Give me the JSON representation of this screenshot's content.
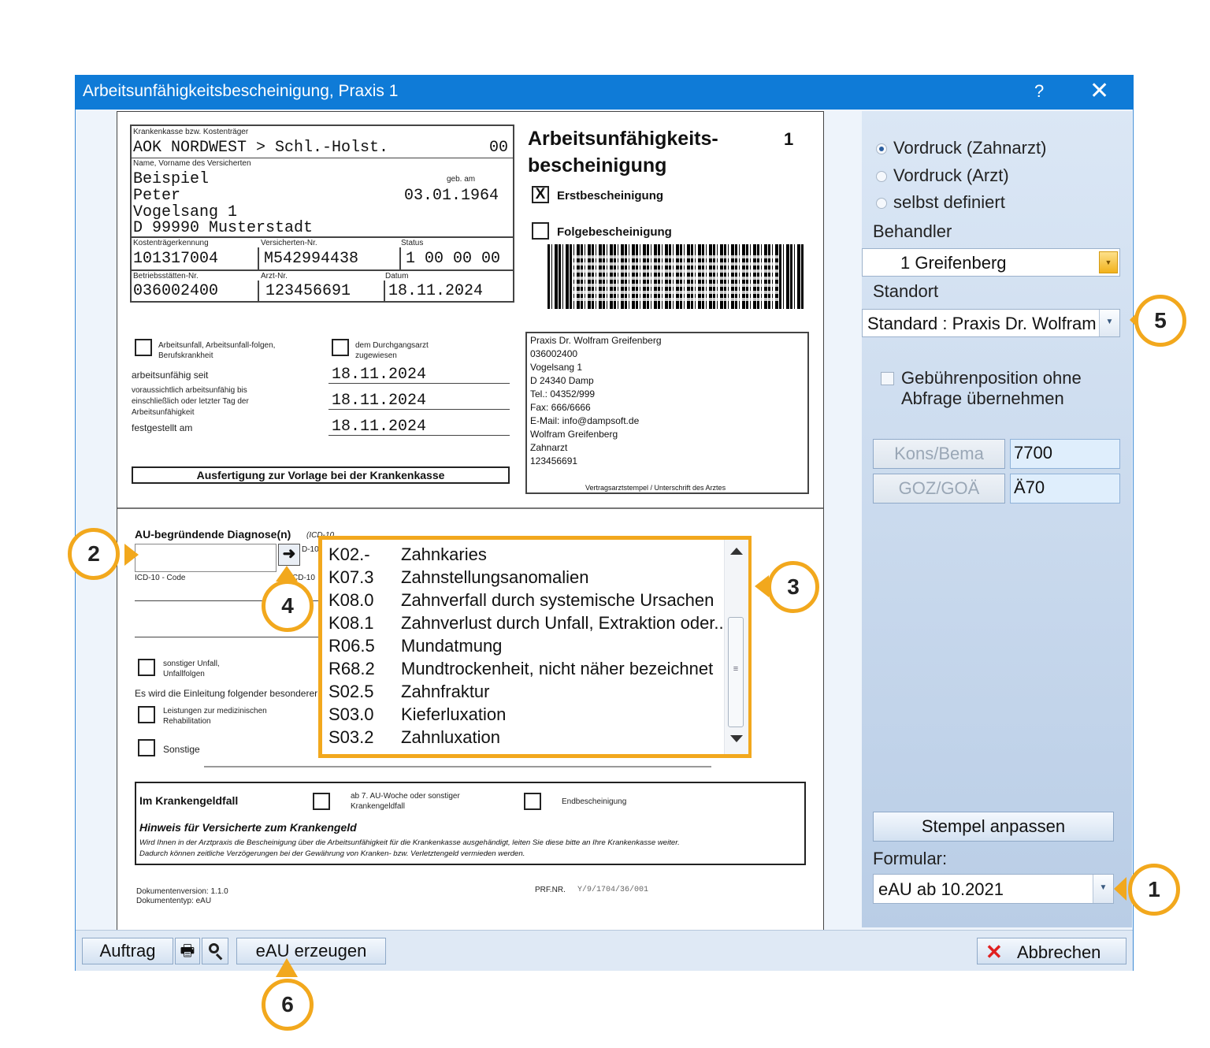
{
  "window": {
    "title": "Arbeitsunfähigkeitsbescheinigung, Praxis 1",
    "help": "?",
    "close": "✕"
  },
  "form": {
    "kasse_label": "Krankenkasse bzw. Kostenträger",
    "kasse_value": "AOK NORDWEST > Schl.-Holst.",
    "kasse_code": "00",
    "name_label": "Name, Vorname des Versicherten",
    "geb_label": "geb. am",
    "name_line1": "Beispiel",
    "name_line2": "Peter",
    "geb_value": "03.01.1964",
    "address_line1": "Vogelsang 1",
    "address_line2": "D 99990 Musterstadt",
    "kostentraeger_label": "Kostenträgerkennung",
    "kostentraeger_value": "101317004",
    "versnr_label": "Versicherten-Nr.",
    "versnr_value": "M542994438",
    "status_label": "Status",
    "status_value": "1 00 00 00",
    "bsnr_label": "Betriebsstätten-Nr.",
    "bsnr_value": "036002400",
    "arztnr_label": "Arzt-Nr.",
    "arztnr_value": "123456691",
    "datum_label": "Datum",
    "datum_value": "18.11.2024",
    "title_line1": "Arbeitsunfähigkeits-",
    "title_line2": "bescheinigung",
    "title_number": "1",
    "erst_mark": "X",
    "erst_label": "Erstbescheinigung",
    "folge_label": "Folgebescheinigung",
    "unfall_label": "Arbeitsunfall, Arbeitsunfall-folgen, Berufskrankheit",
    "durchgang_label": "dem Durchgangsarzt zugewiesen",
    "au_seit_label": "arbeitsunfähig seit",
    "au_seit_value": "18.11.2024",
    "au_bis_label": "voraussichtlich arbeitsunfähig bis einschließlich oder letzter Tag der Arbeitsunfähigkeit",
    "au_bis_value": "18.11.2024",
    "festgestellt_label": "festgestellt am",
    "festgestellt_value": "18.11.2024",
    "ausfertigung": "Ausfertigung zur Vorlage bei der Krankenkasse",
    "stamp_lines": [
      "Praxis Dr. Wolfram Greifenberg",
      "036002400",
      "Vogelsang 1",
      "D 24340 Damp",
      "Tel.: 04352/999",
      "Fax: 666/6666",
      "E-Mail: info@dampsoft.de",
      "Wolfram Greifenberg",
      "Zahnarzt",
      "123456691"
    ],
    "stamp_caption": "Vertragsarztstempel / Unterschrift des Arztes",
    "diagnose_label": "AU-begründende Diagnose(n)",
    "diagnose_suffix": "(ICD-10",
    "icd_code_label": "ICD-10 - Code",
    "icd_frag_1": "D-10",
    "icd_frag_2": "CD-10",
    "sonstiger_unfall_label": "sonstiger Unfall, Unfallfolgen",
    "einleitung_label": "Es wird die Einleitung folgender besonderer M",
    "reha_label": "Leistungen zur medizinischen Rehabilitation",
    "sonstige_label": "Sonstige",
    "krankengeld_title": "Im Krankengeldfall",
    "krankengeld_opt1": "ab 7. AU-Woche oder sonstiger Krankengeldfall",
    "krankengeld_opt2": "Endbescheinigung",
    "hinweis_title": "Hinweis für Versicherte zum Krankengeld",
    "hinweis_text1": "Wird Ihnen in der Arztpraxis die Bescheinigung über die Arbeitsunfähigkeit für die Krankenkasse ausgehändigt, leiten Sie diese bitte an Ihre Krankenkasse weiter.",
    "hinweis_text2": "Dadurch können zeitliche Verzögerungen bei der Gewährung von Kranken- bzw. Verletztengeld vermieden werden.",
    "docversion": "Dokumentenversion: 1.1.0",
    "doctyp": "Dokumententyp: eAU",
    "prf_label": "PRF.NR.",
    "prf_value": "Y/9/1704/36/001"
  },
  "diagnosis_list": [
    {
      "code": "K02.-",
      "desc": "Zahnkaries"
    },
    {
      "code": "K07.3",
      "desc": "Zahnstellungsanomalien"
    },
    {
      "code": "K08.0",
      "desc": "Zahnverfall durch systemische Ursachen"
    },
    {
      "code": "K08.1",
      "desc": "Zahnverlust durch Unfall, Extraktion oder.."
    },
    {
      "code": "R06.5",
      "desc": "Mundatmung"
    },
    {
      "code": "R68.2",
      "desc": "Mundtrockenheit, nicht näher bezeichnet"
    },
    {
      "code": "S02.5",
      "desc": "Zahnfraktur"
    },
    {
      "code": "S03.0",
      "desc": "Kieferluxation"
    },
    {
      "code": "S03.2",
      "desc": "Zahnluxation"
    }
  ],
  "panel": {
    "radio1": "Vordruck (Zahnarzt)",
    "radio2": "Vordruck (Arzt)",
    "radio3": "selbst definiert",
    "behandler_label": "Behandler",
    "behandler_value": "1 Greifenberg",
    "standort_label": "Standort",
    "standort_value": "Standard : Praxis Dr. Wolfram",
    "gebuehr_line1": "Gebührenposition ohne",
    "gebuehr_line2": "Abfrage übernehmen",
    "kons_label": "Kons/Bema",
    "kons_value": "7700",
    "goz_label": "GOZ/GOÄ",
    "goz_value": "Ä70",
    "stempel_button": "Stempel anpassen",
    "formular_label": "Formular:",
    "formular_value": "eAU ab 10.2021"
  },
  "bottom": {
    "auftrag": "Auftrag",
    "eau": "eAU erzeugen",
    "abbrechen": "Abbrechen"
  },
  "callouts": {
    "c1": "1",
    "c2": "2",
    "c3": "3",
    "c4": "4",
    "c5": "5",
    "c6": "6"
  },
  "colors": {
    "titlebar": "#0f7bd7",
    "highlight": "#f2a81d",
    "cancel_x": "#e02020"
  },
  "icons": [
    "arrow-right-icon",
    "print-icon",
    "magnifier-icon",
    "close-icon",
    "chevron-down-icon",
    "scroll-up-icon",
    "scroll-down-icon"
  ]
}
